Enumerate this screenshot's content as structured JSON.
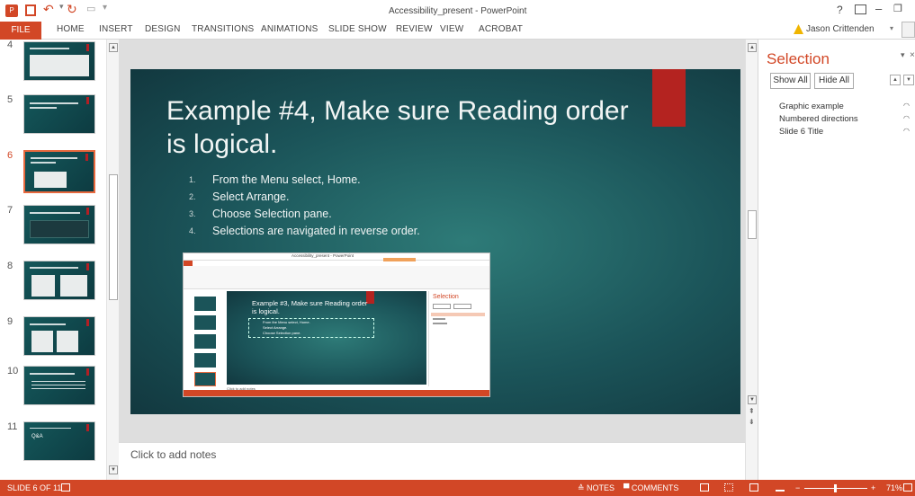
{
  "window": {
    "title": "Accessibility_present - PowerPoint",
    "user": "Jason Crittenden"
  },
  "ribbon": {
    "tabs": [
      "FILE",
      "HOME",
      "INSERT",
      "DESIGN",
      "TRANSITIONS",
      "ANIMATIONS",
      "SLIDE SHOW",
      "REVIEW",
      "VIEW",
      "ACROBAT"
    ]
  },
  "thumbnails": [
    {
      "num": "4",
      "title": "Example #3, Applying columns",
      "selected": false
    },
    {
      "num": "5",
      "title": "Example #2, Use hyperlinks that are meaningful",
      "selected": false
    },
    {
      "num": "6",
      "title": "Example #4, Make sure Reading order is logical",
      "selected": true
    },
    {
      "num": "7",
      "title": "Example #5, Include caption for videos",
      "selected": false
    },
    {
      "num": "8",
      "title": "Use PowerPoint example",
      "selected": false
    },
    {
      "num": "9",
      "title": "Making PDFs accessible",
      "selected": false
    },
    {
      "num": "10",
      "title": "Making PDFs accessible (part 2)",
      "selected": false
    },
    {
      "num": "11",
      "title": "Thank you for your time today!",
      "selected": false
    }
  ],
  "thumb11_sub": "Q&A",
  "slide": {
    "title": "Example #4, Make sure Reading order is logical.",
    "list": [
      {
        "n": "1.",
        "text": "From the Menu select, Home."
      },
      {
        "n": "2.",
        "text": "Select Arrange."
      },
      {
        "n": "3.",
        "text": "Choose Selection pane."
      },
      {
        "n": "4.",
        "text": "Selections are navigated in reverse order."
      }
    ],
    "screenshot": {
      "title": "Accessibility_present - PowerPoint",
      "slide_title": "Example #3, Make sure Reading order is logical.",
      "items": [
        "From the Menu select, Home.",
        "Select Arrange.",
        "Choose Selection pane."
      ],
      "pane_title": "Selection",
      "notes": "Click to add notes"
    }
  },
  "notes": {
    "placeholder": "Click to add notes"
  },
  "selection_pane": {
    "title": "Selection",
    "show_all": "Show All",
    "hide_all": "Hide All",
    "items": [
      "Graphic example",
      "Numbered directions",
      "Slide 6 Title"
    ]
  },
  "status": {
    "slide": "SLIDE 6 OF 11",
    "notes": "NOTES",
    "comments": "COMMENTS",
    "zoom": "71%"
  },
  "colors": {
    "accent": "#d24726",
    "slide_bg": "#1b5459",
    "red_block": "#b42320"
  }
}
